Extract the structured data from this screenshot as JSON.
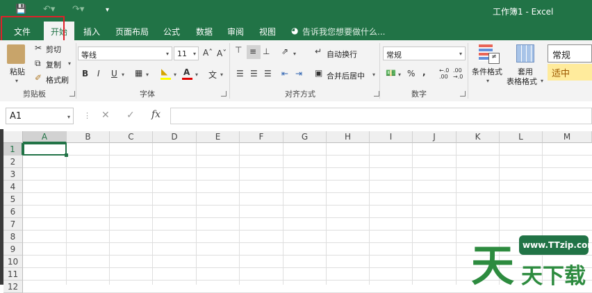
{
  "titlebar": {
    "title": "工作簿1 - Excel",
    "save_icon": "save-icon",
    "undo_icon": "undo-icon",
    "redo_icon": "redo-icon",
    "customize_icon": "customize-icon",
    "bg": "#217346"
  },
  "tabs": [
    "文件",
    "开始",
    "插入",
    "页面布局",
    "公式",
    "数据",
    "审阅",
    "视图"
  ],
  "tellme": "告诉我您想要做什么...",
  "clipboard": {
    "paste": "粘贴",
    "cut": "剪切",
    "copy": "复制",
    "format_painter": "格式刷",
    "group": "剪贴板"
  },
  "font": {
    "name": "等线",
    "size": "11",
    "bold": "B",
    "italic": "I",
    "underline": "U",
    "font_color_letter": "A",
    "pinyin": "文",
    "group": "字体"
  },
  "alignment": {
    "wrap": "自动换行",
    "merge": "合并后居中",
    "group": "对齐方式"
  },
  "number": {
    "format": "常规",
    "percent": "%",
    "comma": ",",
    "inc_decimal": ".0→.00",
    "dec_decimal": ".00→.0",
    "group": "数字"
  },
  "styles": {
    "conditional": "条件格式",
    "table1": "套用",
    "table2": "表格格式",
    "normal": "常规",
    "neutral": "适中"
  },
  "formulabar": {
    "namebox": "A1",
    "cancel": "✕",
    "enter": "✓",
    "fx": "fx",
    "value": ""
  },
  "grid": {
    "columns": [
      "A",
      "B",
      "C",
      "D",
      "E",
      "F",
      "G",
      "H",
      "I",
      "J",
      "K",
      "L",
      "M"
    ],
    "rows": [
      "1",
      "2",
      "3",
      "4",
      "5",
      "6",
      "7",
      "8",
      "9",
      "10",
      "11",
      "12"
    ],
    "active_cell": "A1"
  },
  "watermark": {
    "url": "www.TTzip.com",
    "big_char": "天",
    "text": "天下载"
  }
}
